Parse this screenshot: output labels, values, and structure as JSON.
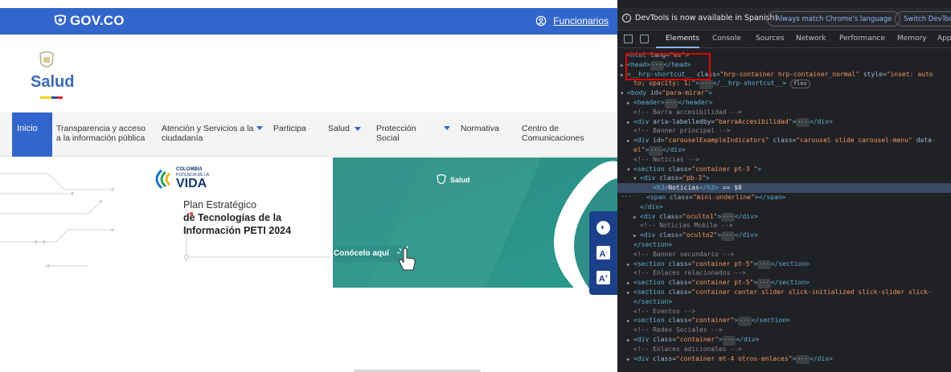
{
  "gov_header": {
    "logo_text": "GOV.CO",
    "funcionarios_label": "Funcionarios",
    "bg_color": "#3366cc"
  },
  "brand": {
    "name": "Salud",
    "name_color": "#3b6ab6"
  },
  "nav": {
    "items": [
      {
        "label": "Inicio",
        "active": true
      },
      {
        "label": "Transparencia y acceso a la información pública"
      },
      {
        "label": "Atención y Servicios a la ciudadanía",
        "dropdown": true
      },
      {
        "label": "Participa"
      },
      {
        "label": "Salud",
        "dropdown": true
      },
      {
        "label": "Protección Social",
        "dropdown": true
      },
      {
        "label": "Normativa"
      },
      {
        "label": "Centro de Comunicaciones"
      }
    ]
  },
  "hero": {
    "vida_line1": "COLOMBIA",
    "vida_line2": "POTENCIA DE LA",
    "vida_line3": "VIDA",
    "plan_line1": "Plan Estratégico",
    "plan_line2": "de Tecnologías de la",
    "plan_line3": "Información PETI 2024",
    "banner_logo_text": "Salud",
    "cta_label": "Conócelo aquí",
    "green_color": "#2e8f87"
  },
  "accessibility": {
    "buttons": [
      "contrast-icon",
      "font-decrease-icon",
      "font-increase-icon"
    ]
  },
  "devtools": {
    "infobar_message": "DevTools is now available in Spanish!",
    "infobar_button1": "Always match Chrome's language",
    "infobar_button2": "Switch DevTools",
    "tabs": [
      "Elements",
      "Console",
      "Sources",
      "Network",
      "Performance",
      "Memory",
      "App"
    ],
    "active_tab": "Elements",
    "lines": [
      {
        "indent": 0,
        "arrow": "",
        "html": "<span class='tg'>&lt;html</span> <span class='an'>lang</span>=<span class='av'>\"es\"</span><span class='tg'>&gt;</span>"
      },
      {
        "indent": 0,
        "arrow": "▶",
        "html": "<span class='tg'>&lt;head&gt;</span><span class='ell'>···</span><span class='tg'>&lt;/head&gt;</span>"
      },
      {
        "indent": 0,
        "arrow": "▶",
        "html": "<span class='tg'>&lt;__hrp-shortcut__</span> <span class='an'>class</span>=<span class='av'>\"hrp-container hrp-container_normal\"</span> <span class='an'>style</span>=<span class='av'>\"inset: auto</span>"
      },
      {
        "indent": 1,
        "arrow": "",
        "html": "<span class='av'>to; opacity: 1;\"</span><span class='tg'>&gt;</span><span class='ell'>···</span><span class='tg'>&lt;/__hrp-shortcut__&gt;</span> <span class='flex'>flex</span>"
      },
      {
        "indent": 0,
        "arrow": "▼",
        "html": "<span class='tg'>&lt;body</span> <span class='an'>id</span>=<span class='av'>\"para-mirar\"</span><span class='tg'>&gt;</span>"
      },
      {
        "indent": 1,
        "arrow": "▶",
        "html": "<span class='tg'>&lt;header&gt;</span><span class='ell'>···</span><span class='tg'>&lt;/header&gt;</span>"
      },
      {
        "indent": 1,
        "arrow": "",
        "html": "<span class='cm'>&lt;!-- Barra accesibilidad --&gt;</span>"
      },
      {
        "indent": 1,
        "arrow": "▶",
        "html": "<span class='tg'>&lt;div</span> <span class='an'>aria-labelledby</span>=<span class='av'>\"barraAccesibilidad\"</span><span class='tg'>&gt;</span><span class='ell'>···</span><span class='tg'>&lt;/div&gt;</span>"
      },
      {
        "indent": 1,
        "arrow": "",
        "html": "<span class='cm'>&lt;!-- Banner principal --&gt;</span>"
      },
      {
        "indent": 1,
        "arrow": "▶",
        "html": "<span class='tg'>&lt;div</span> <span class='an'>id</span>=<span class='av'>\"carouselExampleIndicators\"</span> <span class='an'>class</span>=<span class='av'>\"carousel slide carousel-menu\"</span> <span class='an'>data-</span>"
      },
      {
        "indent": 1,
        "arrow": "",
        "html": "<span class='av'>el\"</span><span class='tg'>&gt;</span><span class='ell'>···</span><span class='tg'>&lt;/div&gt;</span>"
      },
      {
        "indent": 1,
        "arrow": "",
        "html": "<span class='cm'>&lt;!-- Noticias --&gt;</span>"
      },
      {
        "indent": 1,
        "arrow": "▼",
        "html": "<span class='tg'>&lt;section</span> <span class='an'>class</span>=<span class='av'>\"container pt-3 \"</span><span class='tg'>&gt;</span>"
      },
      {
        "indent": 2,
        "arrow": "▼",
        "html": "<span class='tg'>&lt;div</span> <span class='an'>class</span>=<span class='av'>\"pb-3\"</span><span class='tg'>&gt;</span>"
      },
      {
        "indent": 3,
        "arrow": "",
        "sel": true,
        "html": "<span class='tg'>&lt;h3&gt;</span><span class='tx'>Noticias</span><span class='tg'>&lt;/h3&gt;</span> <span class='tx'>== $0</span>"
      },
      {
        "indent": 3,
        "arrow": "",
        "html": "<span class='tg'>&lt;span</span> <span class='an'>class</span>=<span class='av'>\"mini-underline\"</span><span class='tg'>&gt;&lt;/span&gt;</span>"
      },
      {
        "indent": 2,
        "arrow": "",
        "html": "<span class='tg'>&lt;/div&gt;</span>"
      },
      {
        "indent": 2,
        "arrow": "▶",
        "html": "<span class='tg'>&lt;div</span> <span class='an'>class</span>=<span class='av'>\"oculto1\"</span><span class='tg'>&gt;</span><span class='ell'>···</span><span class='tg'>&lt;/div&gt;</span>"
      },
      {
        "indent": 2,
        "arrow": "",
        "html": "<span class='cm'>&lt;!-- Noticias Mobile --&gt;</span>"
      },
      {
        "indent": 2,
        "arrow": "▶",
        "html": "<span class='tg'>&lt;div</span> <span class='an'>class</span>=<span class='av'>\"oculto2\"</span><span class='tg'>&gt;</span><span class='ell'>···</span><span class='tg'>&lt;/div&gt;</span>"
      },
      {
        "indent": 1,
        "arrow": "",
        "html": "<span class='tg'>&lt;/section&gt;</span>"
      },
      {
        "indent": 1,
        "arrow": "",
        "html": "<span class='cm'>&lt;!-- Banner secundario --&gt;</span>"
      },
      {
        "indent": 1,
        "arrow": "▶",
        "html": "<span class='tg'>&lt;section</span> <span class='an'>class</span>=<span class='av'>\"container pt-5\"</span><span class='tg'>&gt;</span><span class='ell'>···</span><span class='tg'>&lt;/section&gt;</span>"
      },
      {
        "indent": 1,
        "arrow": "",
        "html": "<span class='cm'>&lt;!-- Enlaces relacionados --&gt;</span>"
      },
      {
        "indent": 1,
        "arrow": "▶",
        "html": "<span class='tg'>&lt;section</span> <span class='an'>class</span>=<span class='av'>\"container pt-5\"</span><span class='tg'>&gt;</span><span class='ell'>···</span><span class='tg'>&lt;/section&gt;</span>"
      },
      {
        "indent": 1,
        "arrow": "▶",
        "html": "<span class='tg'>&lt;section</span> <span class='an'>class</span>=<span class='av'>\"container center slider slick-initialized slick-slider slick-</span>"
      },
      {
        "indent": 1,
        "arrow": "",
        "html": "<span class='tg'>&lt;/section&gt;</span>"
      },
      {
        "indent": 1,
        "arrow": "",
        "html": "<span class='cm'>&lt;!-- Eventos --&gt;</span>"
      },
      {
        "indent": 1,
        "arrow": "▶",
        "html": "<span class='tg'>&lt;section</span> <span class='an'>class</span>=<span class='av'>\"container\"</span><span class='tg'>&gt;</span><span class='ell'>···</span><span class='tg'>&lt;/section&gt;</span>"
      },
      {
        "indent": 1,
        "arrow": "",
        "html": "<span class='cm'>&lt;!-- Redes Sociales --&gt;</span>"
      },
      {
        "indent": 1,
        "arrow": "▶",
        "html": "<span class='tg'>&lt;div</span> <span class='an'>class</span>=<span class='av'>\"container\"</span><span class='tg'>&gt;</span><span class='ell'>···</span><span class='tg'>&lt;/div&gt;</span>"
      },
      {
        "indent": 1,
        "arrow": "",
        "html": "<span class='cm'>&lt;!-- Enlaces adicionales --&gt;</span>"
      },
      {
        "indent": 1,
        "arrow": "▶",
        "html": "<span class='tg'>&lt;div</span> <span class='an'>class</span>=<span class='av'>\"container mt-4 otros-enlaces\"</span><span class='tg'>&gt;</span><span class='ell'>···</span><span class='tg'>&lt;/div&gt;</span>"
      }
    ]
  }
}
